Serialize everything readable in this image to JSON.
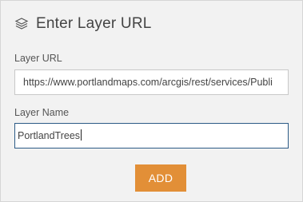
{
  "header": {
    "icon": "layers-icon",
    "title": "Enter Layer URL"
  },
  "form": {
    "url_label": "Layer URL",
    "url_value": "https://www.portlandmaps.com/arcgis/rest/services/Publi",
    "name_label": "Layer Name",
    "name_value": "PortlandTrees"
  },
  "actions": {
    "add_label": "ADD"
  },
  "colors": {
    "accent": "#e28f37",
    "focus_border": "#2c5b86"
  }
}
